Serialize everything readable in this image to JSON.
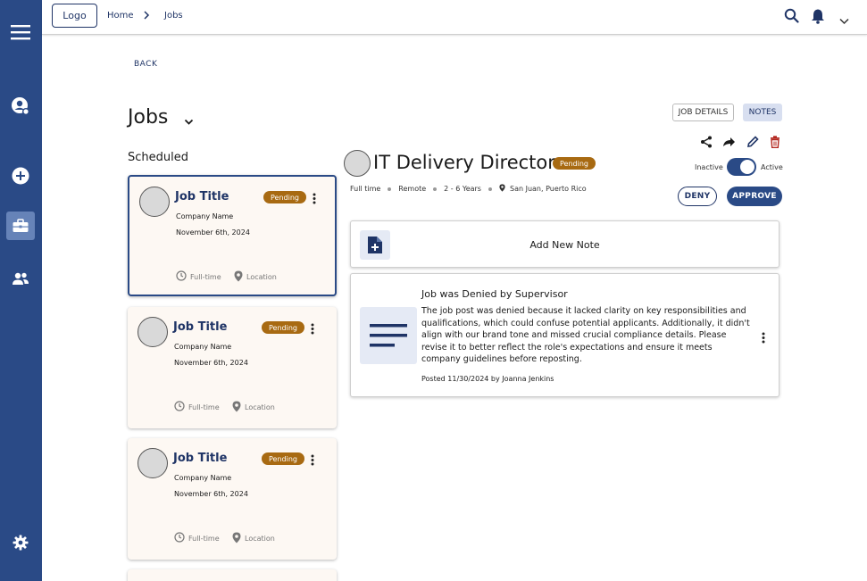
{
  "header": {
    "logo": "Logo",
    "breadcrumb": [
      "Home",
      "Jobs"
    ]
  },
  "back_label": "BACK",
  "page_title": "Jobs",
  "section_label": "Scheduled",
  "job_cards": [
    {
      "title": "Job Title",
      "status": "Pending",
      "company": "Company Name",
      "date": "November 6th, 2024",
      "type": "Full-time",
      "location": "Location"
    },
    {
      "title": "Job Title",
      "status": "Pending",
      "company": "Company Name",
      "date": "November 6th, 2024",
      "type": "Full-time",
      "location": "Location"
    },
    {
      "title": "Job Title",
      "status": "Pending",
      "company": "Company Name",
      "date": "November 6th, 2024",
      "type": "Full-time",
      "location": "Location"
    }
  ],
  "detail": {
    "tabs": {
      "details": "JOB DETAILS",
      "notes": "NOTES"
    },
    "title": "IT Delivery Director",
    "status": "Pending",
    "toggle": {
      "inactive": "Inactive",
      "active": "Active",
      "on": true
    },
    "meta": {
      "type": "Full time",
      "mode": "Remote",
      "experience": "2 - 6 Years",
      "location": "San Juan, Puerto Rico"
    },
    "deny_label": "DENY",
    "approve_label": "APPROVE",
    "add_note_label": "Add New Note",
    "note": {
      "title": "Job was Denied by Supervisor",
      "body": "The job post was denied because it lacked clarity on key responsibilities and qualifications, which could confuse potential applicants. Additionally, it didn't align with our brand tone and missed crucial compliance details. Please revise it to better reflect the role's expectations and ensure it meets company guidelines before reposting.",
      "posted": "Posted 11/30/2024 by Joanna Jenkins"
    }
  },
  "colors": {
    "sidebar": "#2a4a86",
    "badge": "#a86a12",
    "primary": "#1f3466",
    "card_bg": "#fdf8f3",
    "delete": "#b3261e"
  }
}
